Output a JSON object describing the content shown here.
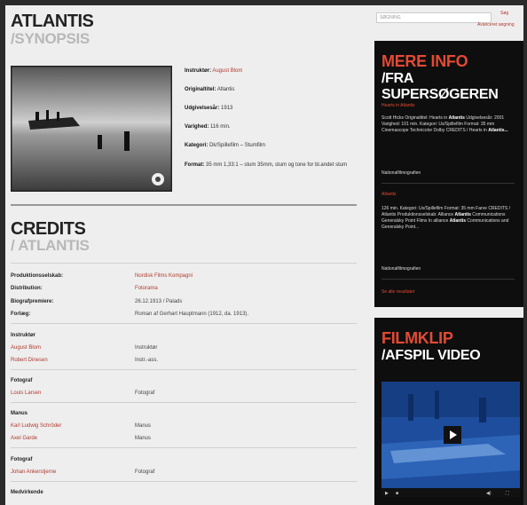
{
  "page": {
    "title": "ATLANTIS",
    "subtitle": "/SYNOPSIS"
  },
  "film_meta": {
    "director_label": "Instruktør:",
    "director_value": "August Blom",
    "original_title_label": "Originaltitel:",
    "original_title_value": "Atlantis",
    "year_label": "Udgivelsesår:",
    "year_value": "1913",
    "length_label": "Varighed:",
    "length_value": "116 min.",
    "category_label": "Kategori:",
    "category_value": "Dk/Spillefilm – Stumfilm",
    "format_label": "Format:",
    "format_value": "35 mm 1,33:1 – stum 35mm, stum og tone for bl.andet stum"
  },
  "credits": {
    "title": "CREDITS",
    "subtitle": "/ ATLANTIS",
    "rows": [
      {
        "label": "Produktionsselskab:",
        "value": "Nordisk Films Kompagni"
      },
      {
        "label": "Distribution:",
        "value": "Fotorama"
      },
      {
        "label": "Biografpremiere:",
        "value": "26.12.1913 / Palads"
      },
      {
        "label": "Forlæg:",
        "value": "Roman af Gerhart Hauptmann (1912, da. 1913)."
      }
    ],
    "groups": [
      {
        "heading": "Instruktør",
        "people": [
          {
            "name": "August Blom",
            "role": "Instruktør"
          },
          {
            "name": "Robert Dinesen",
            "role": "Instr.-ass."
          }
        ]
      },
      {
        "heading": "Fotograf",
        "people": [
          {
            "name": "Louis Larsen",
            "role": "Fotograf"
          }
        ]
      },
      {
        "heading": "Manus",
        "people": [
          {
            "name": "Karl Ludwig Schröder",
            "role": "Manus"
          },
          {
            "name": "Axel Garde",
            "role": "Manus"
          }
        ]
      },
      {
        "heading": "Fotograf",
        "people": [
          {
            "name": "Johan Ankerstjerne",
            "role": "Fotograf"
          }
        ]
      },
      {
        "heading": "Medvirkende",
        "people": []
      }
    ]
  },
  "sidebar": {
    "search_placeholder": "SØGNING",
    "search_button": "Søg",
    "advanced_search": "Avanceret søgning",
    "panel1_title": "MERE INFO",
    "panel1_sub": "/FRA SUPERSØGEREN",
    "panel1_link1": "Hearts in Atlantis",
    "panel1_text1_pre": "Scott Hicks Originaltitel: Hearts in ",
    "panel1_text1_bold": "Atlantis",
    "panel1_text1_post": " Udgivelsesår: 2001 Varighed: 101 min. Kategori: Us/Spillefilm Format: 35 mm Cinemascope Technicolor Dolby CREDITS / Hearts in ",
    "panel1_text1_end": "Atlantis...",
    "panel1_source1": "Nationalfilmografien",
    "panel1_link2": "Atlantis",
    "panel1_text2_pre": "126 min. Kategori: Us/Spillefilm Format: 35 mm Farve CREDITS / Atlantis Produktionsselskab: Alliance ",
    "panel1_text2_bold": "Atlantis",
    "panel1_text2_mid": " Communications Generalsky Point Films In alliance ",
    "panel1_text2_bold2": "Atlantis",
    "panel1_text2_post": " Communications and Generalsky Point...",
    "panel1_source2": "Nationalfilmografien",
    "panel1_more": "Se alle resultater",
    "panel2_title": "FILMKLIP",
    "panel2_sub": "/AFSPIL VIDEO"
  },
  "video": {
    "progress": 0.0
  }
}
